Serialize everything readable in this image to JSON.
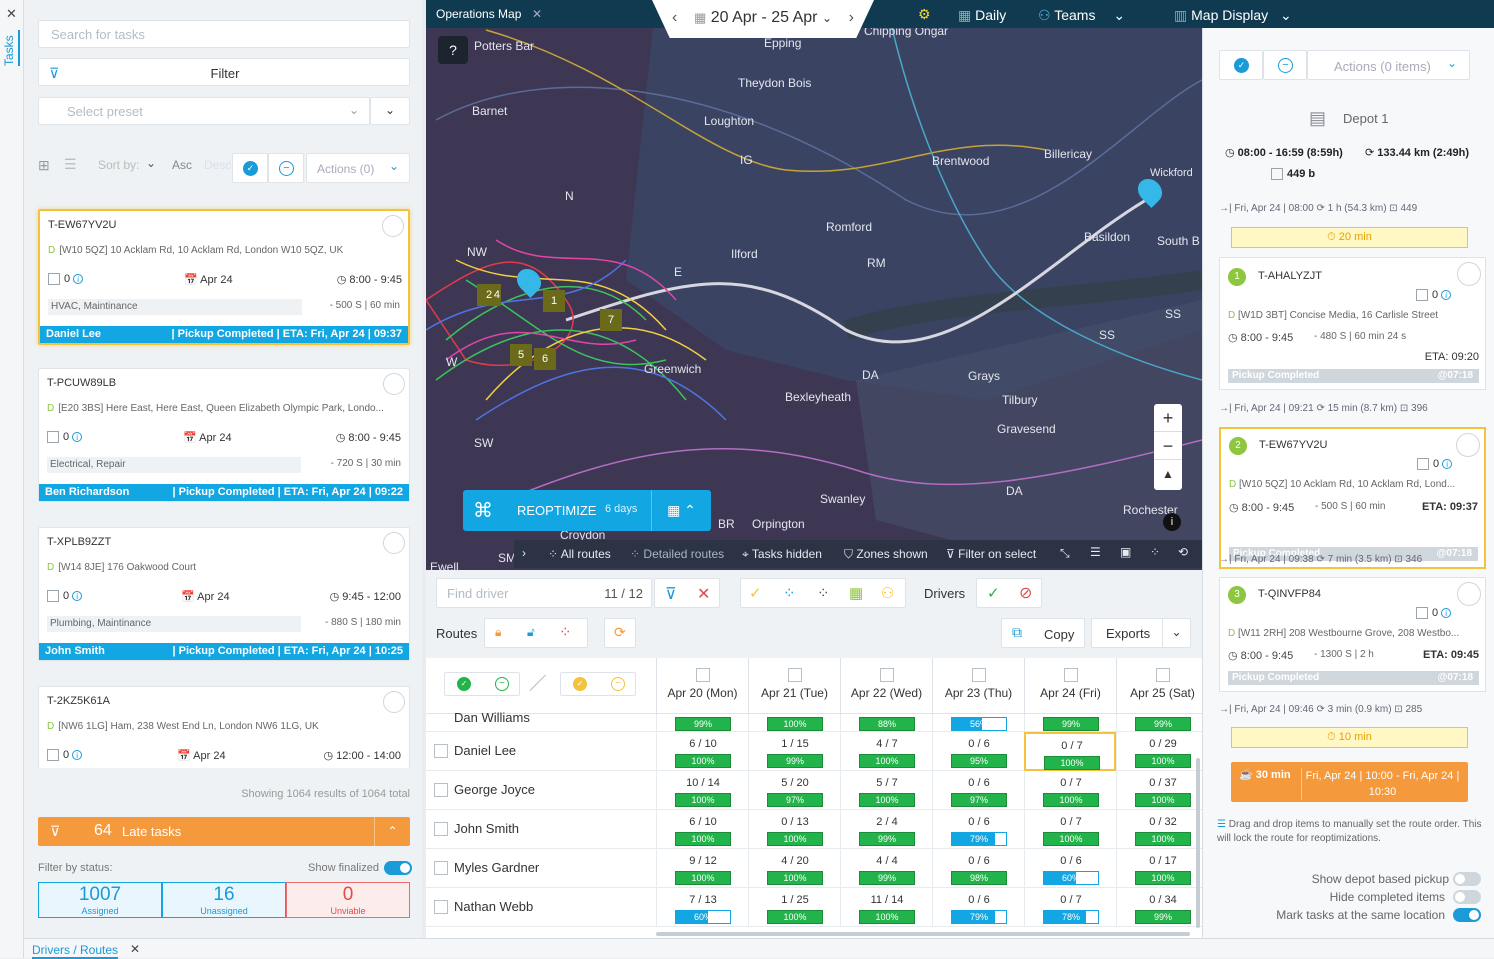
{
  "tasks_tab": {
    "close": "✕",
    "label": "Tasks"
  },
  "left": {
    "search_placeholder": "Search for tasks",
    "filter_label": "Filter",
    "preset_placeholder": "Select preset",
    "sort_by": "Sort by:",
    "asc": "Asc",
    "desc": "Desc",
    "actions": "Actions (0)",
    "cards": [
      {
        "id": "T-EW67YV2U",
        "addr": "[W10 5QZ] 10 Acklam Rd, 10 Acklam Rd, London W10 5QZ, UK",
        "count": "0",
        "date": "Apr 24",
        "time": "8:00 - 9:45",
        "tags": "HVAC, Maintinance",
        "price": "- 500  S | 60 min",
        "driver": "Daniel Lee",
        "status": "| Pickup Completed | ETA: Fri, Apr 24 | 09:37"
      },
      {
        "id": "T-PCUW89LB",
        "addr": "[E20 3BS] Here East, Here East, Queen Elizabeth Olympic Park, Londo...",
        "count": "0",
        "date": "Apr 24",
        "time": "8:00 - 9:45",
        "tags": "Electrical, Repair",
        "price": "- 720  S | 30 min",
        "driver": "Ben Richardson",
        "status": "| Pickup Completed | ETA: Fri, Apr 24 | 09:22"
      },
      {
        "id": "T-XPLB9ZZT",
        "addr": "[W14 8JE] 176 Oakwood Court",
        "count": "0",
        "date": "Apr 24",
        "time": "9:45 - 12:00",
        "tags": "Plumbing, Maintinance",
        "price": "- 880  S | 180 min",
        "driver": "John Smith",
        "status": "| Pickup Completed | ETA: Fri, Apr 24 | 10:25"
      },
      {
        "id": "T-2KZ5K61A",
        "addr": "[NW6 1LG] Ham, 238 West End Ln, London NW6 1LG, UK",
        "count": "0",
        "date": "Apr 24",
        "time": "12:00 - 14:00"
      }
    ],
    "showing": "Showing 1064 results of 1064 total",
    "late_count": "64",
    "late_label": "Late tasks",
    "filter_status": "Filter by status:",
    "show_finalized": "Show finalized",
    "stats": [
      {
        "n": "1007",
        "l": "Assigned"
      },
      {
        "n": "16",
        "l": "Unassigned"
      },
      {
        "n": "0",
        "l": "Unviable"
      }
    ]
  },
  "map": {
    "tab": "Operations Map",
    "tab_close": "✕",
    "date_range": "20 Apr - 25 Apr",
    "daily": "Daily",
    "teams": "Teams",
    "map_display": "Map Display",
    "places": [
      "Potters Bar",
      "Epping",
      "Chipping Ongar",
      "Barnet",
      "Theydon Bois",
      "Loughton",
      "Brentwood",
      "Billericay",
      "Wickford",
      "Romford",
      "Basildon",
      "South B",
      "Ilford",
      "RM",
      "NW",
      "E",
      "N",
      "IG",
      "SS",
      "SS",
      "Greenwich",
      "DA",
      "Grays",
      "Tilbury",
      "Bexleyheath",
      "Gravesend",
      "SW",
      "Swanley",
      "DA",
      "Rochester",
      "BR",
      "Orpington",
      "Croydon",
      "SM",
      "Ewell",
      "W"
    ],
    "clusters": [
      "2",
      "4",
      "1",
      "7",
      "5",
      "6"
    ],
    "reopt": "REOPTIMIZE",
    "reopt_days": "6 days",
    "toolbar": [
      "All routes",
      "Detailed routes",
      "Tasks hidden",
      "Zones shown",
      "Filter on select"
    ]
  },
  "bottom": {
    "find_driver": "Find driver",
    "driver_count": "11 / 12",
    "drivers": "Drivers",
    "routes": "Routes",
    "copy": "Copy",
    "exports": "Exports",
    "days": [
      "Apr 20 (Mon)",
      "Apr 21 (Tue)",
      "Apr 22 (Wed)",
      "Apr 23 (Thu)",
      "Apr 24 (Fri)",
      "Apr 25 (Sat)"
    ],
    "rows": [
      {
        "name": "Dan Williams",
        "cells": [
          {
            "f": "",
            "p": "99%",
            "v": 99
          },
          {
            "f": "",
            "p": "100%",
            "v": 100
          },
          {
            "f": "",
            "p": "88%",
            "v": 88
          },
          {
            "f": "",
            "p": "56%",
            "v": 56
          },
          {
            "f": "",
            "p": "99%",
            "v": 99
          },
          {
            "f": "",
            "p": "99%",
            "v": 99
          }
        ]
      },
      {
        "name": "Daniel Lee",
        "cells": [
          {
            "f": "6 / 10",
            "p": "100%",
            "v": 100
          },
          {
            "f": "1 / 15",
            "p": "99%",
            "v": 99
          },
          {
            "f": "4 / 7",
            "p": "100%",
            "v": 100
          },
          {
            "f": "0 / 6",
            "p": "95%",
            "v": 95
          },
          {
            "f": "0 / 7",
            "p": "100%",
            "v": 100
          },
          {
            "f": "0 / 29",
            "p": "100%",
            "v": 100
          }
        ]
      },
      {
        "name": "George Joyce",
        "cells": [
          {
            "f": "10 / 14",
            "p": "100%",
            "v": 100
          },
          {
            "f": "5 / 20",
            "p": "97%",
            "v": 97
          },
          {
            "f": "5 / 7",
            "p": "100%",
            "v": 100
          },
          {
            "f": "0 / 6",
            "p": "97%",
            "v": 97
          },
          {
            "f": "0 / 7",
            "p": "100%",
            "v": 100
          },
          {
            "f": "0 / 37",
            "p": "100%",
            "v": 100
          }
        ]
      },
      {
        "name": "John Smith",
        "cells": [
          {
            "f": "6 / 10",
            "p": "100%",
            "v": 100
          },
          {
            "f": "0 / 13",
            "p": "100%",
            "v": 100
          },
          {
            "f": "2 / 4",
            "p": "99%",
            "v": 99
          },
          {
            "f": "0 / 6",
            "p": "79%",
            "v": 79
          },
          {
            "f": "0 / 7",
            "p": "100%",
            "v": 100
          },
          {
            "f": "0 / 32",
            "p": "100%",
            "v": 100
          }
        ]
      },
      {
        "name": "Myles Gardner",
        "cells": [
          {
            "f": "9 / 12",
            "p": "100%",
            "v": 100
          },
          {
            "f": "4 / 20",
            "p": "100%",
            "v": 100
          },
          {
            "f": "4 / 4",
            "p": "99%",
            "v": 99
          },
          {
            "f": "0 / 6",
            "p": "98%",
            "v": 98
          },
          {
            "f": "0 / 6",
            "p": "60%",
            "v": 60
          },
          {
            "f": "0 / 17",
            "p": "100%",
            "v": 100
          }
        ]
      },
      {
        "name": "Nathan Webb",
        "cells": [
          {
            "f": "7 / 13",
            "p": "60%",
            "v": 60
          },
          {
            "f": "1 / 25",
            "p": "100%",
            "v": 100
          },
          {
            "f": "11 / 14",
            "p": "100%",
            "v": 100
          },
          {
            "f": "0 / 6",
            "p": "79%",
            "v": 79
          },
          {
            "f": "0 / 7",
            "p": "78%",
            "v": 78
          },
          {
            "f": "0 / 34",
            "p": "99%",
            "v": 99
          }
        ]
      }
    ],
    "footer_tab": "Drivers / Routes",
    "footer_close": "✕"
  },
  "right": {
    "actions": "Actions (0 items)",
    "depot": "Depot 1",
    "depot_time": "08:00 - 16:59 (8:59h)",
    "depot_dist": "133.44 km (2:49h)",
    "depot_b": "449 b",
    "leg0": "→| Fri, Apr 24 | 08:00   ⟳ 1 h (54.3 km)   ⊡ 449",
    "wait0": "⏱ 20 min",
    "stops": [
      {
        "n": "1",
        "id": "T-AHALYZJT",
        "count": "0",
        "addr": "[W1D 3BT] Concise Media, 16 Carlisle Street",
        "time": "8:00 - 9:45",
        "price": "- 480    S | 60 min 24 s",
        "eta": "ETA: 09:20",
        "status": "Pickup Completed",
        "late": "@07:18"
      },
      {
        "n": "2",
        "id": "T-EW67YV2U",
        "count": "0",
        "addr": "[W10 5QZ] 10 Acklam Rd, 10 Acklam Rd, Lond...",
        "time": "8:00 - 9:45",
        "price": "- 500    S | 60 min",
        "eta": "ETA: 09:37",
        "status": "Pickup Completed",
        "late": "@07:18"
      },
      {
        "n": "3",
        "id": "T-QINVFP84",
        "count": "0",
        "addr": "[W11 2RH] 208 Westbourne Grove, 208 Westbo...",
        "time": "8:00 - 9:45",
        "price": "- 1300    S | 2 h",
        "eta": "ETA: 09:45",
        "status": "Pickup Completed",
        "late": "@07:18"
      }
    ],
    "leg1": "→| Fri, Apr 24 | 09:21   ⟳ 15 min (8.7 km)   ⊡ 396",
    "leg2": "→| Fri, Apr 24 | 09:38   ⟳ 7 min (3.5 km)   ⊡ 346",
    "leg3": "→| Fri, Apr 24 | 09:46   ⟳ 3 min (0.9 km)   ⊡ 285",
    "wait3": "⏱ 10 min",
    "break_dur": "☕ 30 min",
    "break_time": "Fri, Apr 24 | 10:00 - Fri, Apr 24 | 10:30",
    "drag_note": "Drag and drop items to manually set the route order. This will lock the route for reoptimizations.",
    "t1": "Show depot based pickup",
    "t2": "Hide completed items",
    "t3": "Mark tasks at the same location"
  }
}
